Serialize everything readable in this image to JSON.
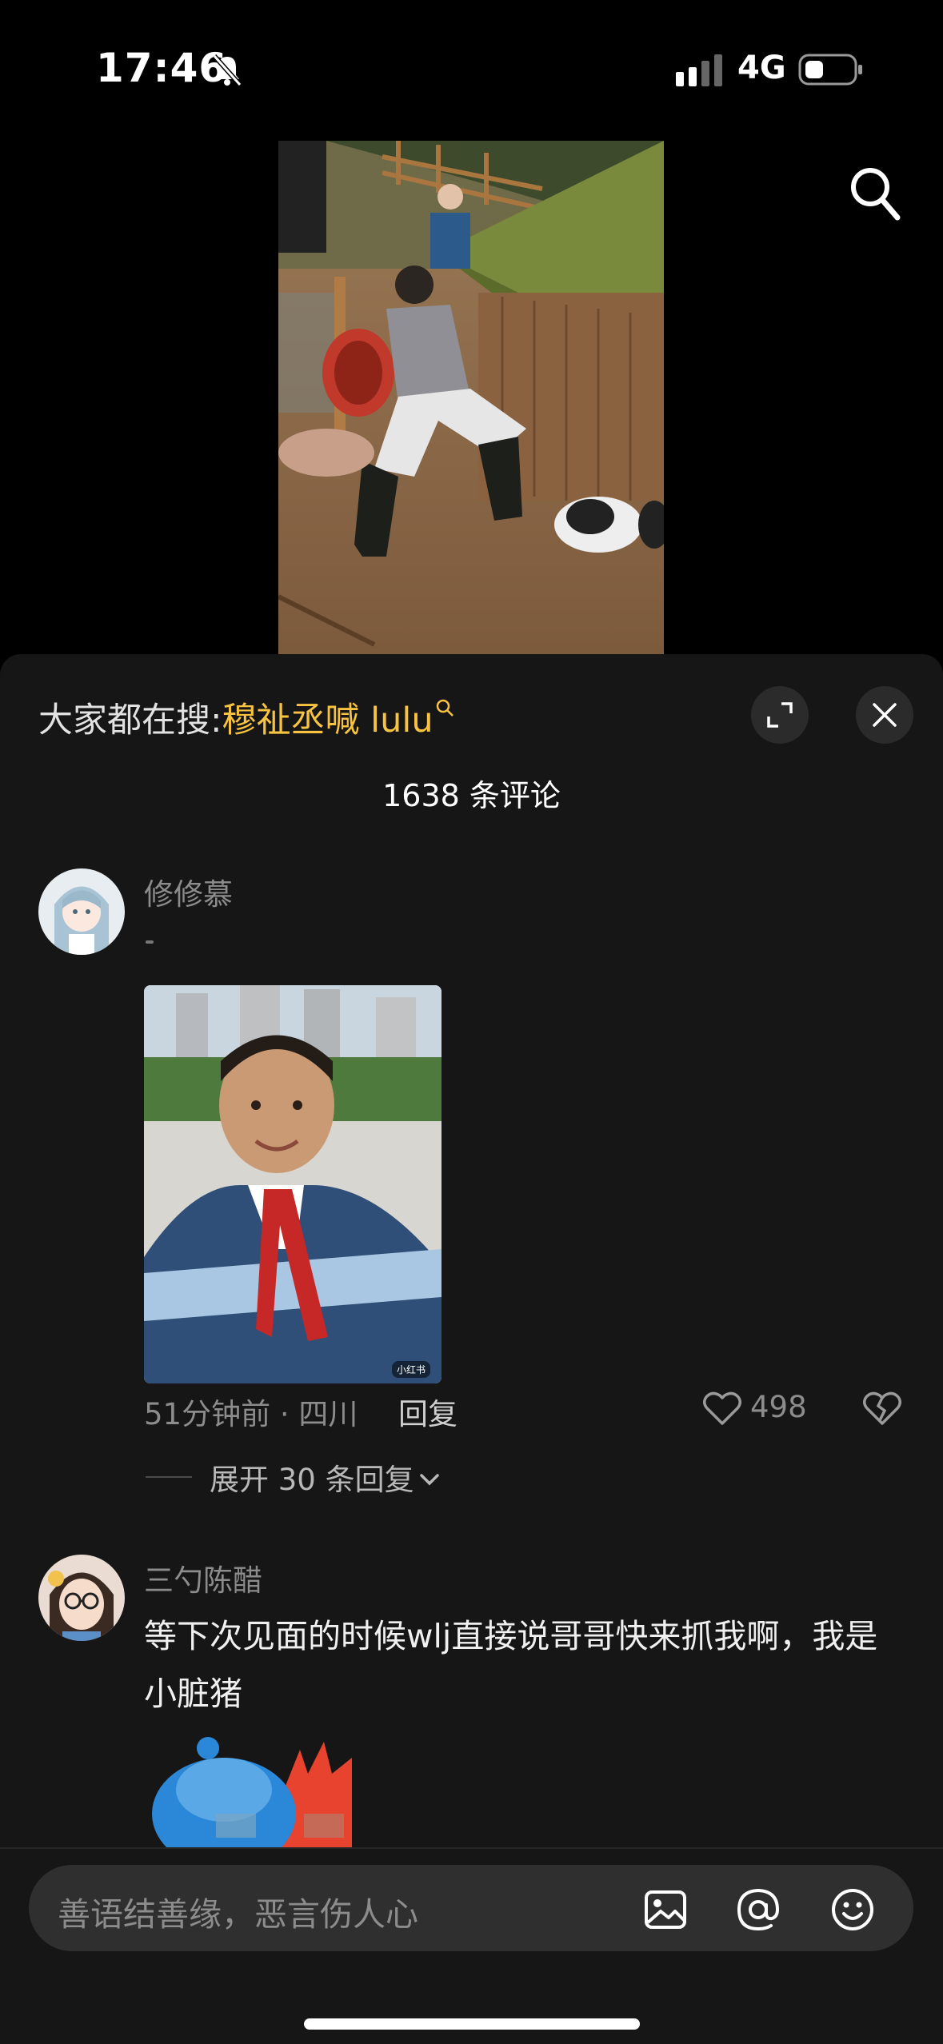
{
  "status": {
    "time": "17:46",
    "network": "4G"
  },
  "icons": {
    "bell": "bell-muted-icon",
    "signal": "signal-icon",
    "battery": "battery-icon",
    "search": "search-icon",
    "expand": "expand-icon",
    "close": "close-icon",
    "like": "heart-icon",
    "dislike": "broken-heart-icon",
    "image": "image-icon",
    "at": "at-icon",
    "emoji": "emoji-icon"
  },
  "colors": {
    "accent": "#f7c340",
    "background": "#161616"
  },
  "sheet": {
    "trending_prefix": "大家都在搜:",
    "trending_keyword": "穆祉丞喊 lulu",
    "comment_count": "1638 条评论"
  },
  "comments": [
    {
      "username": "修修慕",
      "photo_tag": "小红书",
      "time_location": "51分钟前 · 四川",
      "reply": "回复",
      "likes": "498",
      "expand_replies": "展开 30 条回复"
    },
    {
      "username": "三勺陈醋",
      "text": "等下次见面的时候wlj直接说哥哥快来抓我啊，我是小脏猪"
    }
  ],
  "input": {
    "placeholder": "善语结善缘，恶言伤人心"
  }
}
